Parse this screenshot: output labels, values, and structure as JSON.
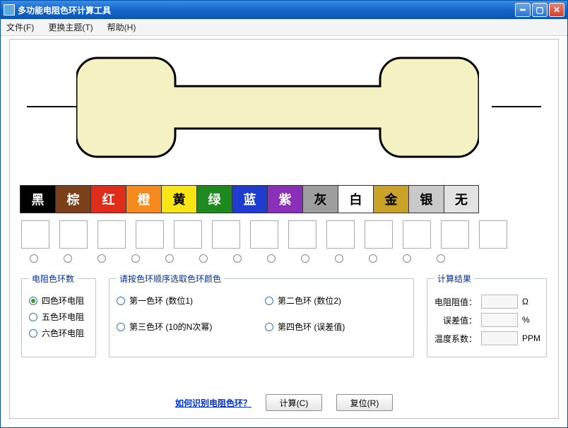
{
  "window": {
    "title": "多功能电阻色环计算工具"
  },
  "menu": {
    "file": "文件(F)",
    "theme": "更换主题(T)",
    "help": "帮助(H)"
  },
  "colors": {
    "items": [
      {
        "label": "黑",
        "bg": "#000000",
        "fg": "#ffffff"
      },
      {
        "label": "棕",
        "bg": "#7b3f1a",
        "fg": "#ffffff"
      },
      {
        "label": "红",
        "bg": "#e02c1b",
        "fg": "#ffffff"
      },
      {
        "label": "橙",
        "bg": "#f58a1f",
        "fg": "#ffffff"
      },
      {
        "label": "黄",
        "bg": "#f7e516",
        "fg": "#000000"
      },
      {
        "label": "绿",
        "bg": "#1e8a1e",
        "fg": "#ffffff"
      },
      {
        "label": "蓝",
        "bg": "#1e3dcf",
        "fg": "#ffffff"
      },
      {
        "label": "紫",
        "bg": "#8a2fb8",
        "fg": "#ffffff"
      },
      {
        "label": "灰",
        "bg": "#9e9e9e",
        "fg": "#000000"
      },
      {
        "label": "白",
        "bg": "#ffffff",
        "fg": "#000000"
      },
      {
        "label": "金",
        "bg": "#c9a227",
        "fg": "#000000"
      },
      {
        "label": "银",
        "bg": "#c9c9c9",
        "fg": "#000000"
      },
      {
        "label": "无",
        "bg": "#e3e3e3",
        "fg": "#000000"
      }
    ]
  },
  "groups": {
    "ringCount": {
      "legend": "电阻色环数",
      "opt4": "四色环电阻",
      "opt5": "五色环电阻",
      "opt6": "六色环电阻"
    },
    "ringSelect": {
      "legend": "请按色环顺序选取色环颜色",
      "r1": "第一色环 (数位1)",
      "r2": "第二色环 (数位2)",
      "r3": "第三色环 (10的N次幂)",
      "r4": "第四色环 (误差值)"
    },
    "result": {
      "legend": "计算结果",
      "resistance": "电阻阻值：",
      "tolerance": "误差值：",
      "tempco": "温度系数：",
      "unit_ohm": "Ω",
      "unit_pct": "%",
      "unit_ppm": "PPM"
    }
  },
  "bottom": {
    "helplink": "如何识别电阻色环？",
    "calc": "计算(C)",
    "reset": "复位(R)"
  }
}
